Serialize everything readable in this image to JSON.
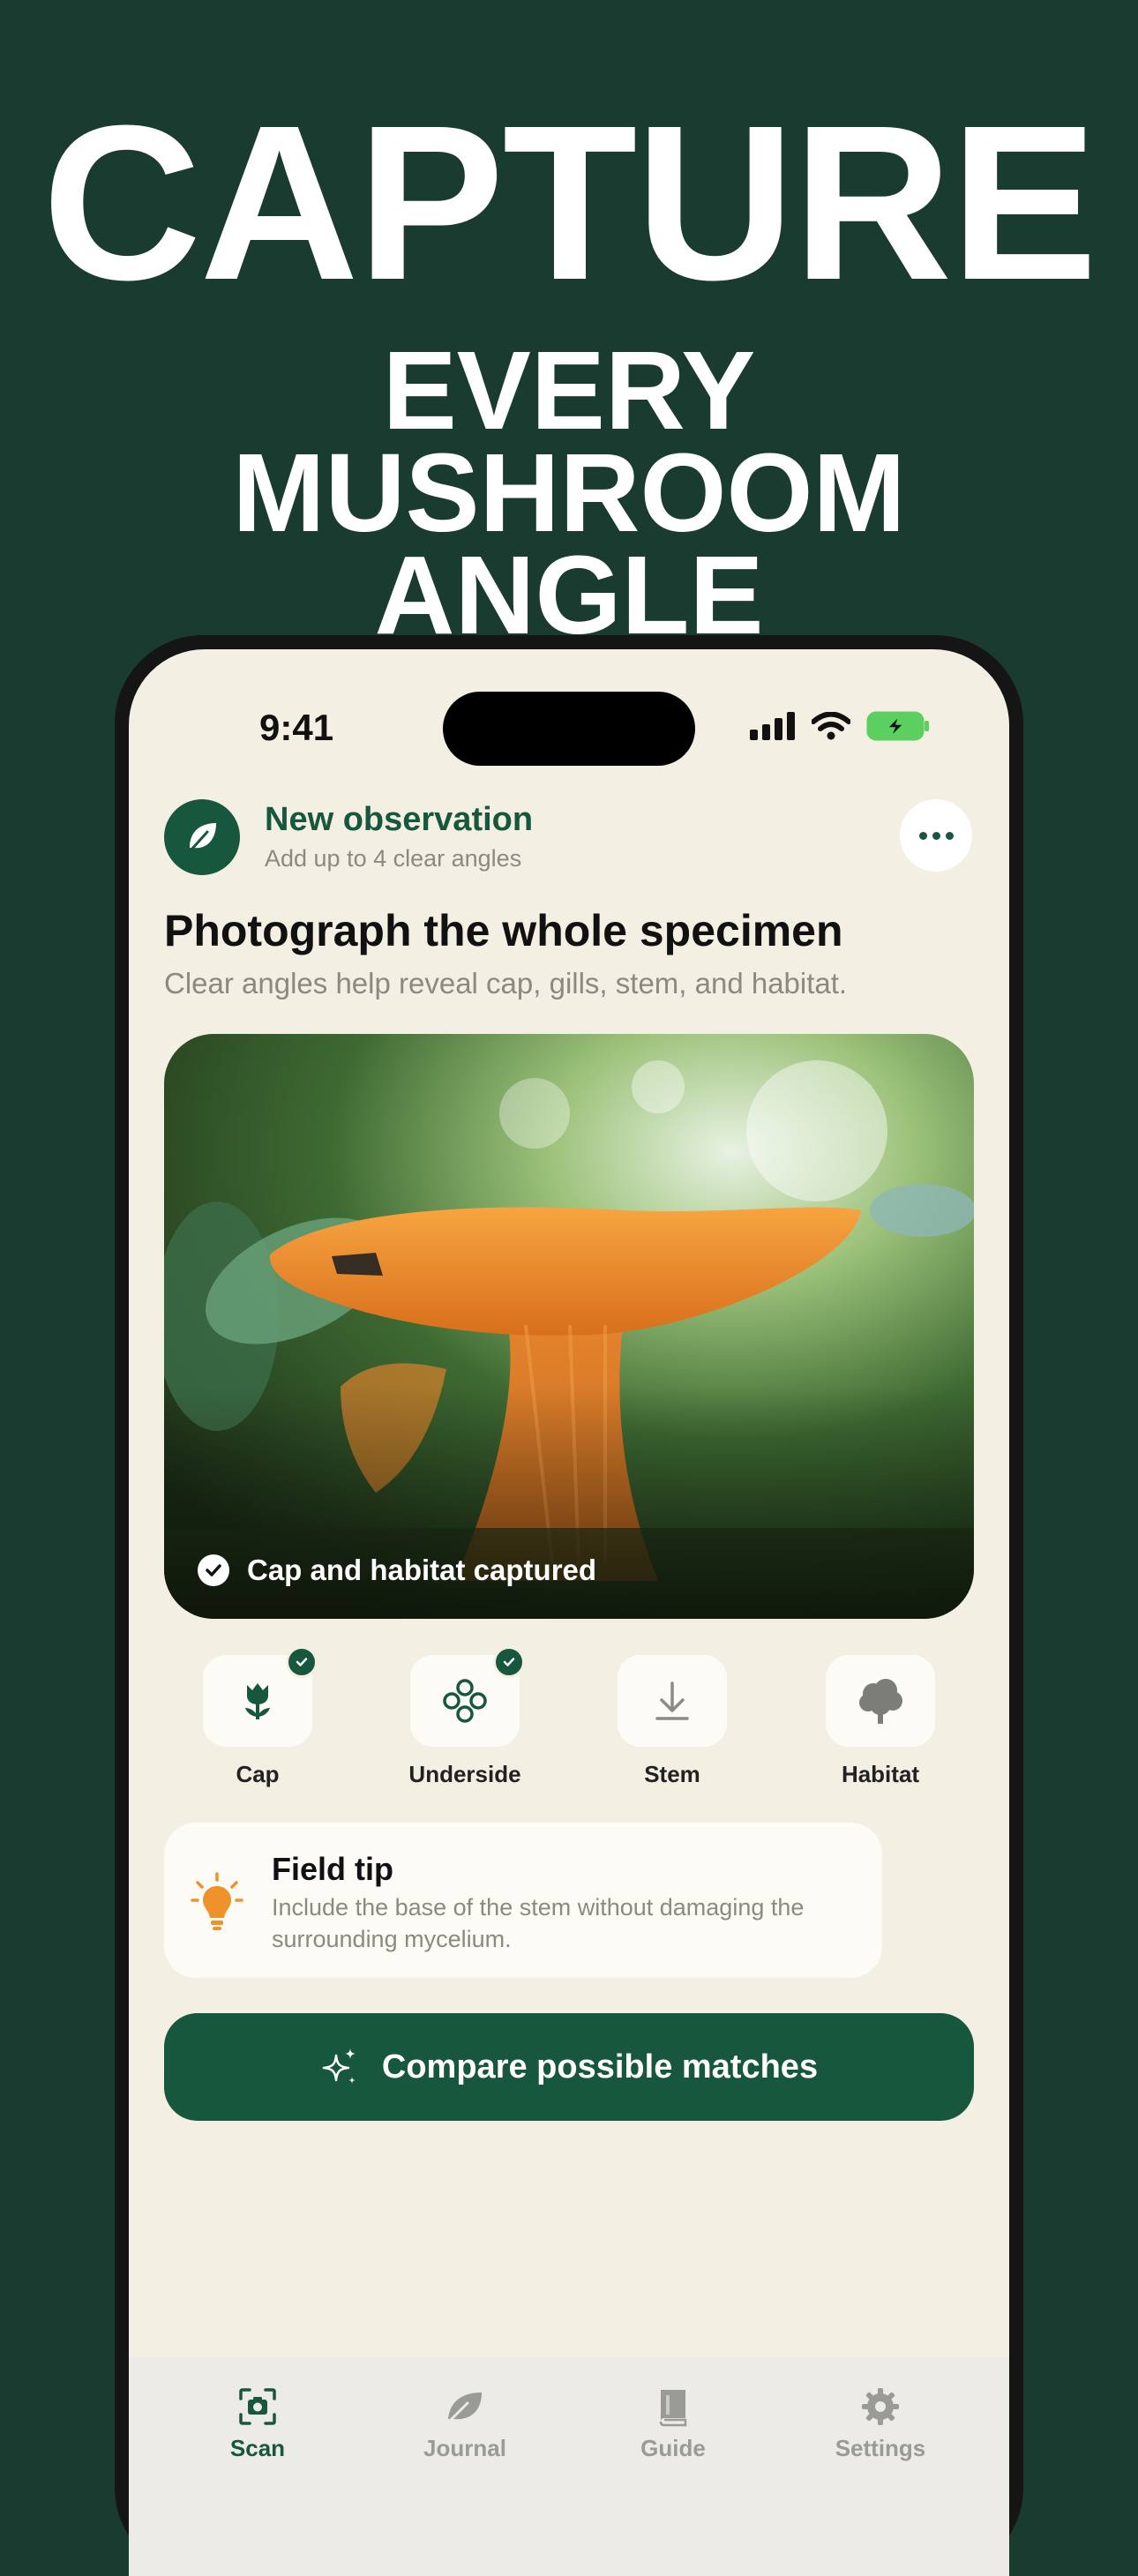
{
  "promo": {
    "line1": "CAPTURE",
    "line2": "EVERY",
    "line3": "MUSHROOM",
    "line4": "ANGLE"
  },
  "status": {
    "time": "9:41"
  },
  "header": {
    "title": "New observation",
    "subtitle": "Add up to 4 clear angles",
    "avatar_icon": "leaf-icon",
    "more_icon": "ellipsis-icon"
  },
  "main": {
    "title": "Photograph the whole specimen",
    "subtitle": "Clear angles help reveal cap, gills, stem, and habitat.",
    "photo_caption": "Cap and habitat captured"
  },
  "angles": [
    {
      "label": "Cap",
      "icon": "tulip-icon",
      "captured": true
    },
    {
      "label": "Underside",
      "icon": "circles-icon",
      "captured": true
    },
    {
      "label": "Stem",
      "icon": "download-arrow-icon",
      "captured": false
    },
    {
      "label": "Habitat",
      "icon": "tree-icon",
      "captured": false
    }
  ],
  "tip": {
    "title": "Field tip",
    "body": "Include the base of the stem without damaging the surrounding mycelium.",
    "icon": "lightbulb-icon"
  },
  "cta": {
    "label": "Compare possible matches",
    "icon": "sparkles-icon"
  },
  "tabs": [
    {
      "label": "Scan",
      "icon": "camera-scan-icon",
      "active": true
    },
    {
      "label": "Journal",
      "icon": "leaf-icon",
      "active": false
    },
    {
      "label": "Guide",
      "icon": "book-icon",
      "active": false
    },
    {
      "label": "Settings",
      "icon": "gear-icon",
      "active": false
    }
  ],
  "colors": {
    "background": "#1a3b2f",
    "screen": "#f4efe3",
    "accent": "#17573d",
    "tip_icon": "#f0922a"
  }
}
